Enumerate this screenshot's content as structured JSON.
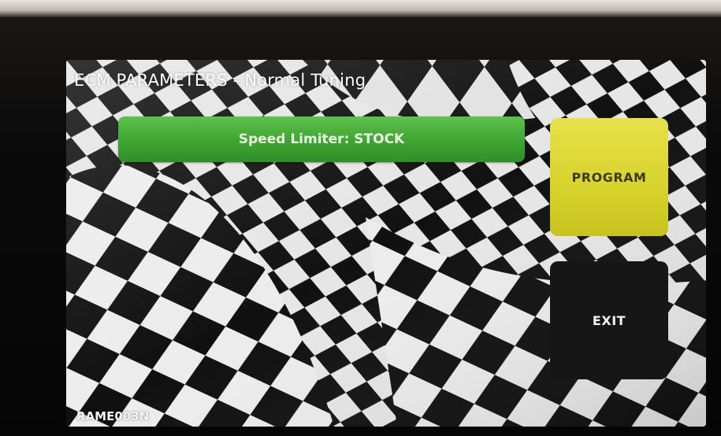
{
  "screen": {
    "title": "ECM PARAMETERS - Normal Tuning",
    "status": "Speed Limiter: STOCK",
    "footer_id": "RAME003N"
  },
  "buttons": {
    "program_label": "PROGRAM",
    "exit_label": "EXIT"
  },
  "colors": {
    "status_bar": "#3fa532",
    "program_button": "#d8d22c",
    "exit_button": "#161616",
    "checker_dark": "#111111",
    "checker_light": "#e6e6e6"
  }
}
